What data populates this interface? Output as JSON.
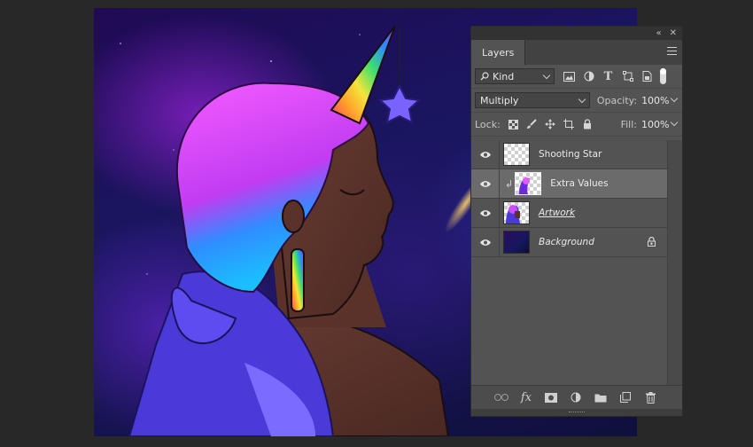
{
  "panel": {
    "title": "Layers",
    "collapse_glyph": "«",
    "close_glyph": "✕"
  },
  "filter": {
    "kind_label": "Kind",
    "icons": [
      "image-filter-icon",
      "adjustment-filter-icon",
      "type-filter-icon",
      "shape-filter-icon",
      "smart-object-filter-icon"
    ],
    "type_glyph": "T"
  },
  "blend": {
    "mode": "Multiply",
    "opacity_label": "Opacity:",
    "opacity_value": "100%"
  },
  "lock": {
    "label": "Lock:",
    "fill_label": "Fill:",
    "fill_value": "100%"
  },
  "layers": [
    {
      "name": "Shooting Star",
      "visible": true,
      "selected": false,
      "clipped": false,
      "locked": false
    },
    {
      "name": "Extra Values",
      "visible": true,
      "selected": true,
      "clipped": true,
      "locked": false
    },
    {
      "name": "Artwork",
      "visible": true,
      "selected": false,
      "clipped": false,
      "locked": false
    },
    {
      "name": "Background",
      "visible": true,
      "selected": false,
      "clipped": false,
      "locked": true
    }
  ],
  "footer": {
    "link_icon": "link-icon",
    "fx_label": "fx",
    "mask_icon": "mask-icon",
    "adjustment_icon": "adjustment-icon",
    "folder_icon": "folder-icon",
    "new_layer_icon": "new-layer-icon",
    "trash_icon": "trash-icon"
  },
  "colors": {
    "panel_bg": "#535353",
    "selected_row": "#6b6b6b",
    "workspace_bg": "#282828"
  }
}
